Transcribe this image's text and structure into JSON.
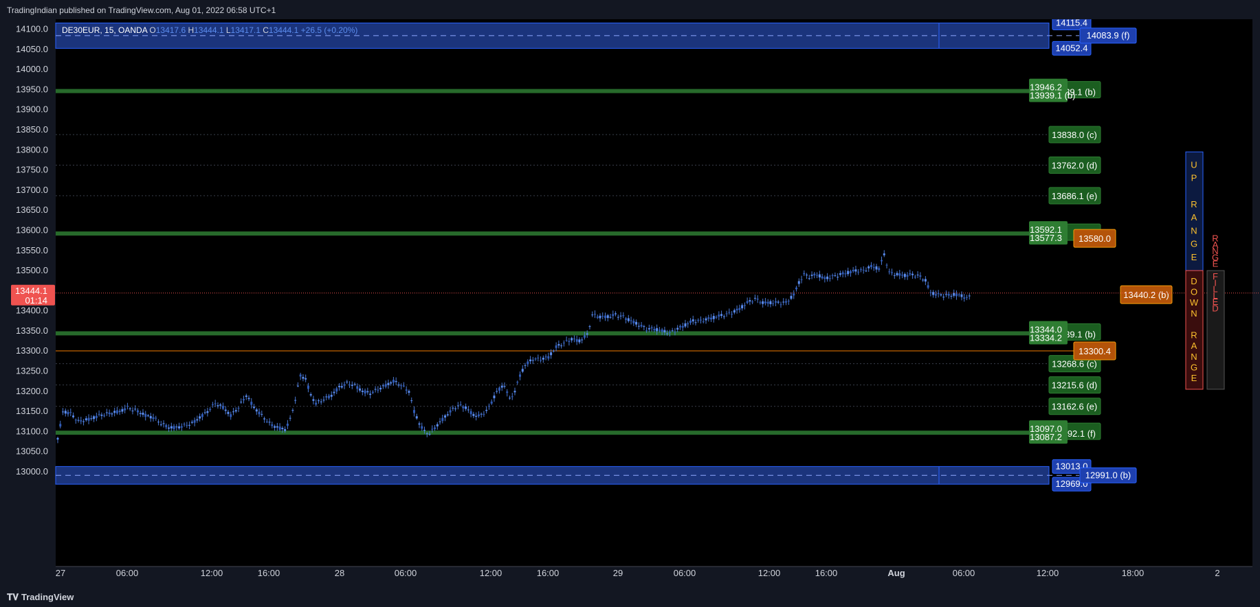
{
  "header": {
    "published": "TradingIndian published on TradingView.com, Aug 01, 2022 06:58 UTC+1"
  },
  "footer": {
    "brand": "TradingView"
  },
  "chart_data": {
    "type": "candlestick",
    "legend": {
      "symbol": "DE30EUR, 15, OANDA",
      "o": "13417.6",
      "h": "13444.1",
      "l": "13417.1",
      "c": "13444.1",
      "change": "+26.5 (+0.20%)"
    },
    "ylim": [
      12960,
      14120
    ],
    "y_ticks": [
      "14100.0",
      "14050.0",
      "14000.0",
      "13950.0",
      "13900.0",
      "13850.0",
      "13800.0",
      "13750.0",
      "13700.0",
      "13650.0",
      "13600.0",
      "13550.0",
      "13500.0",
      "13450.0",
      "13400.0",
      "13350.0",
      "13300.0",
      "13250.0",
      "13200.0",
      "13150.0",
      "13100.0",
      "13050.0",
      "13000.0"
    ],
    "x_ticks": [
      "27",
      "06:00",
      "12:00",
      "16:00",
      "28",
      "06:00",
      "12:00",
      "16:00",
      "29",
      "06:00",
      "12:00",
      "16:00",
      "Aug",
      "06:00",
      "12:00",
      "18:00",
      "2"
    ],
    "x_tick_bold": [
      false,
      false,
      false,
      false,
      false,
      false,
      false,
      false,
      false,
      false,
      false,
      false,
      true,
      false,
      false,
      false,
      false
    ],
    "last_price": {
      "value": "13444.1",
      "countdown": "01:14"
    },
    "zones": [
      {
        "kind": "blue",
        "top": 14115.4,
        "bottom": 14052.4,
        "mid": 14083.9,
        "top_label": "14115.4",
        "bottom_label": "14052.4",
        "mid_label": "14083.9 (f)"
      },
      {
        "kind": "blue",
        "top": 13013.0,
        "bottom": 12969.0,
        "mid": 12991.0,
        "top_label": "13013.0",
        "bottom_label": "12969.0",
        "mid_label": "12991.0 (b)"
      }
    ],
    "green_bands": [
      {
        "value": 13946.2,
        "label": "13946.2",
        "under_label": "13939.1 (b)",
        "right_label": "39.1 (b)"
      },
      {
        "value": 13592.1,
        "label": "13592.1",
        "under_label": "13577.3",
        "right_label": "85.0"
      },
      {
        "value": 13344.0,
        "label": "13344.0",
        "under_label": "13334.2",
        "right_label": "39.1 (b)"
      },
      {
        "value": 13097.0,
        "label": "13097.0",
        "under_label": "13087.2",
        "right_label": "92.1 (f)"
      }
    ],
    "dotted_levels": [
      {
        "value": 13838.0,
        "label": "13838.0 (c)"
      },
      {
        "value": 13762.0,
        "label": "13762.0 (d)"
      },
      {
        "value": 13686.1,
        "label": "13686.1 (e)"
      },
      {
        "value": 13268.6,
        "label": "13268.6 (c)"
      },
      {
        "value": 13215.6,
        "label": "13215.6 (d)"
      },
      {
        "value": 13162.6,
        "label": "13162.6 (e)"
      }
    ],
    "orange_levels": [
      {
        "value": 13580.0,
        "label": "13580.0",
        "line": false
      },
      {
        "value": 13300.4,
        "label": "13300.4",
        "line": true
      },
      {
        "value": 13440.2,
        "label": "13440.2 (b)",
        "line": false
      }
    ],
    "range_boxes": {
      "up": {
        "text": "UP RANGE",
        "top": 13795,
        "bottom": 13500
      },
      "down": {
        "text": "DOWN RANGE",
        "top": 13500,
        "bottom": 13205
      },
      "filled": {
        "text": "RANGE FILLED",
        "top": 13500,
        "bottom": 13205
      }
    },
    "price_path": [
      [
        0,
        13080
      ],
      [
        2,
        13150
      ],
      [
        5,
        13145
      ],
      [
        8,
        13125
      ],
      [
        12,
        13130
      ],
      [
        16,
        13140
      ],
      [
        20,
        13145
      ],
      [
        24,
        13150
      ],
      [
        27,
        13160
      ],
      [
        31,
        13150
      ],
      [
        34,
        13140
      ],
      [
        37,
        13135
      ],
      [
        40,
        13120
      ],
      [
        43,
        13110
      ],
      [
        46,
        13110
      ],
      [
        49,
        13115
      ],
      [
        52,
        13120
      ],
      [
        55,
        13135
      ],
      [
        58,
        13150
      ],
      [
        61,
        13170
      ],
      [
        64,
        13160
      ],
      [
        67,
        13140
      ],
      [
        70,
        13160
      ],
      [
        73,
        13190
      ],
      [
        76,
        13160
      ],
      [
        79,
        13140
      ],
      [
        82,
        13120
      ],
      [
        85,
        13110
      ],
      [
        88,
        13105
      ],
      [
        90,
        13130
      ],
      [
        92,
        13180
      ],
      [
        94,
        13240
      ],
      [
        96,
        13230
      ],
      [
        98,
        13190
      ],
      [
        100,
        13170
      ],
      [
        103,
        13180
      ],
      [
        106,
        13190
      ],
      [
        109,
        13210
      ],
      [
        112,
        13220
      ],
      [
        115,
        13215
      ],
      [
        118,
        13200
      ],
      [
        121,
        13195
      ],
      [
        124,
        13205
      ],
      [
        127,
        13215
      ],
      [
        130,
        13225
      ],
      [
        133,
        13215
      ],
      [
        136,
        13200
      ],
      [
        138,
        13150
      ],
      [
        140,
        13120
      ],
      [
        142,
        13100
      ],
      [
        144,
        13095
      ],
      [
        146,
        13110
      ],
      [
        149,
        13130
      ],
      [
        152,
        13150
      ],
      [
        155,
        13165
      ],
      [
        158,
        13160
      ],
      [
        161,
        13140
      ],
      [
        164,
        13140
      ],
      [
        167,
        13160
      ],
      [
        170,
        13200
      ],
      [
        173,
        13215
      ],
      [
        175,
        13180
      ],
      [
        177,
        13200
      ],
      [
        179,
        13240
      ],
      [
        181,
        13265
      ],
      [
        184,
        13280
      ],
      [
        187,
        13280
      ],
      [
        190,
        13285
      ],
      [
        193,
        13310
      ],
      [
        196,
        13320
      ],
      [
        199,
        13330
      ],
      [
        202,
        13325
      ],
      [
        205,
        13340
      ],
      [
        207,
        13390
      ],
      [
        210,
        13385
      ],
      [
        213,
        13385
      ],
      [
        216,
        13390
      ],
      [
        219,
        13385
      ],
      [
        222,
        13375
      ],
      [
        225,
        13365
      ],
      [
        228,
        13355
      ],
      [
        231,
        13355
      ],
      [
        234,
        13350
      ],
      [
        237,
        13345
      ],
      [
        240,
        13355
      ],
      [
        243,
        13365
      ],
      [
        246,
        13375
      ],
      [
        249,
        13375
      ],
      [
        252,
        13380
      ],
      [
        255,
        13385
      ],
      [
        258,
        13390
      ],
      [
        261,
        13395
      ],
      [
        264,
        13405
      ],
      [
        267,
        13420
      ],
      [
        270,
        13430
      ],
      [
        273,
        13420
      ],
      [
        276,
        13420
      ],
      [
        279,
        13420
      ],
      [
        282,
        13420
      ],
      [
        285,
        13440
      ],
      [
        287,
        13470
      ],
      [
        289,
        13490
      ],
      [
        291,
        13485
      ],
      [
        294,
        13490
      ],
      [
        297,
        13480
      ],
      [
        300,
        13485
      ],
      [
        303,
        13490
      ],
      [
        306,
        13495
      ],
      [
        309,
        13500
      ],
      [
        312,
        13500
      ],
      [
        315,
        13510
      ],
      [
        318,
        13505
      ],
      [
        320,
        13540
      ],
      [
        322,
        13495
      ],
      [
        325,
        13490
      ],
      [
        328,
        13488
      ],
      [
        331,
        13490
      ],
      [
        334,
        13485
      ],
      [
        336,
        13475
      ],
      [
        338,
        13445
      ],
      [
        341,
        13440
      ],
      [
        344,
        13438
      ],
      [
        347,
        13440
      ],
      [
        350,
        13438
      ],
      [
        352,
        13430
      ],
      [
        354,
        13444.1
      ]
    ]
  }
}
